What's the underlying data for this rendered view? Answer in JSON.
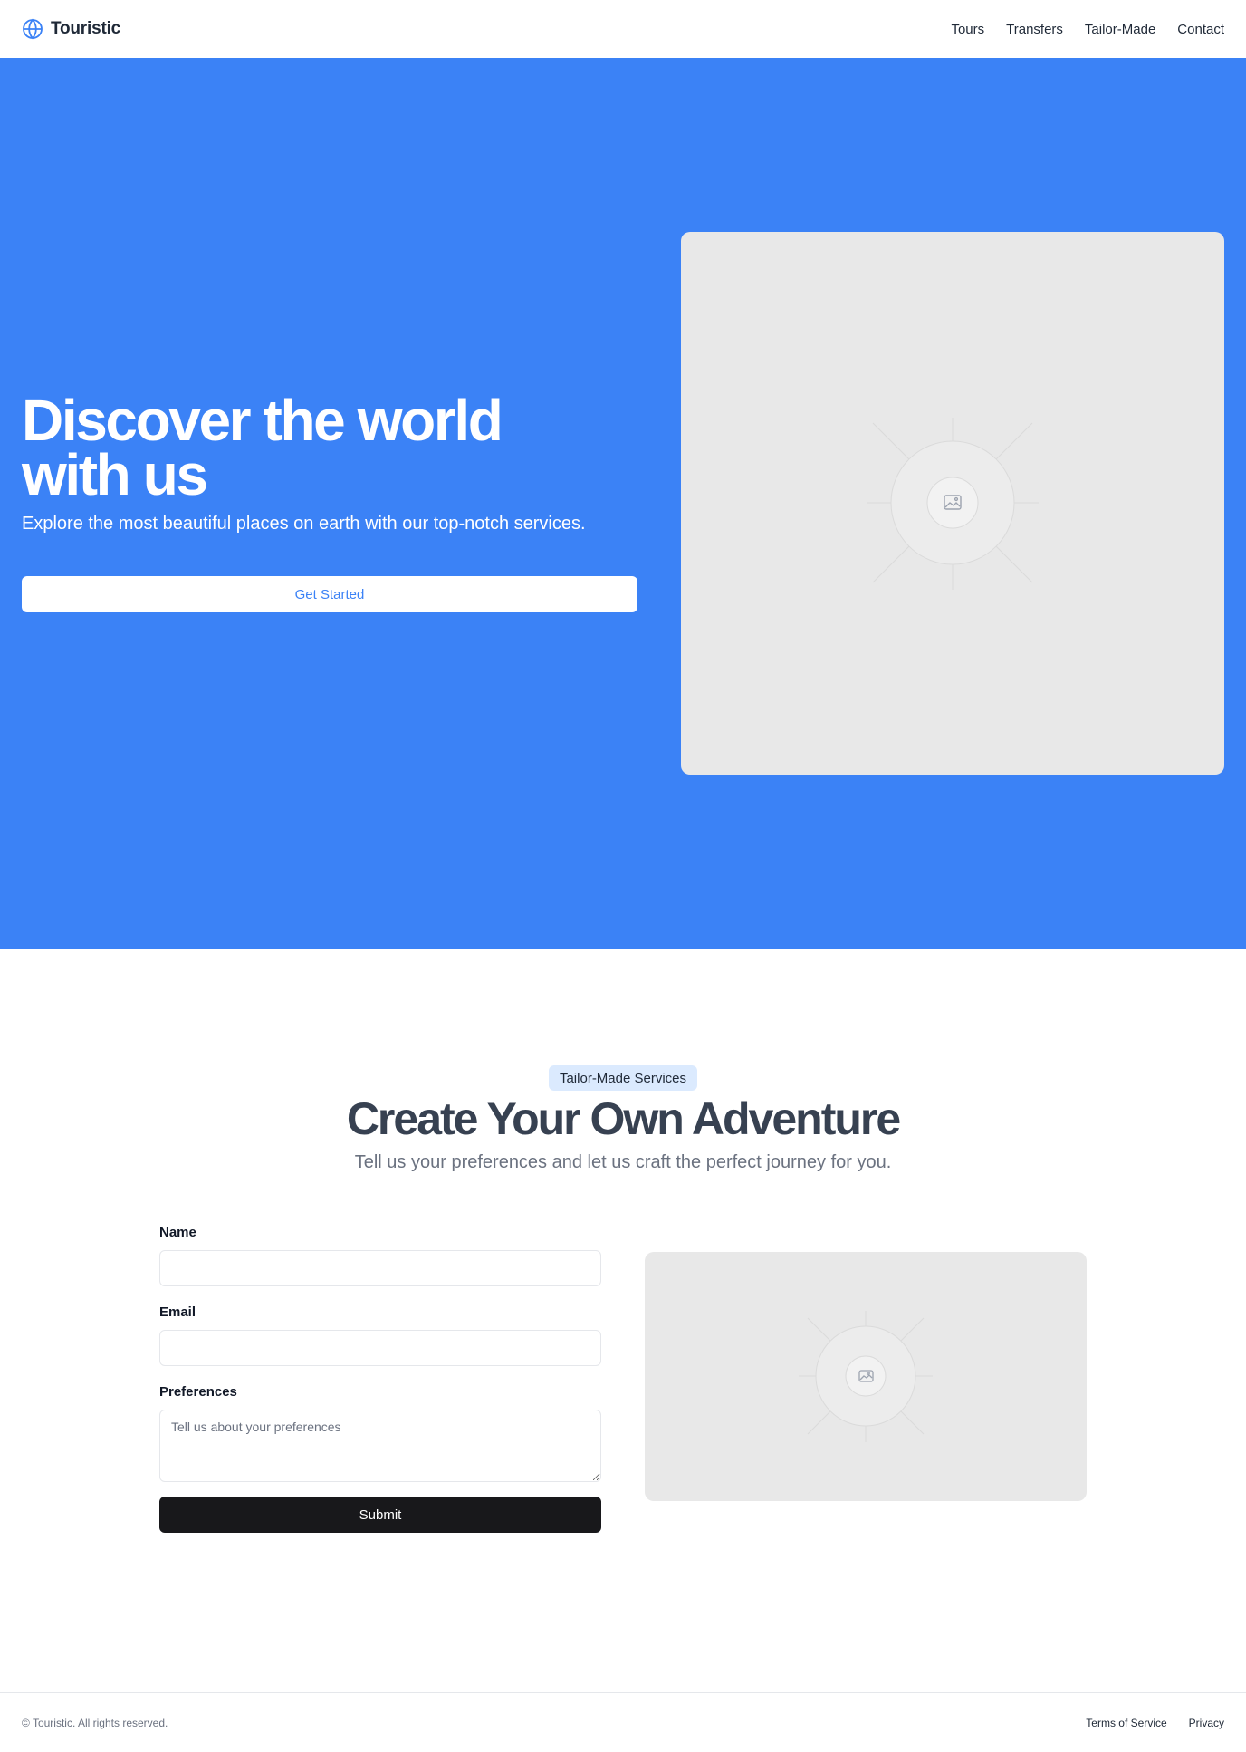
{
  "header": {
    "brand": "Touristic",
    "brand_icon": "globe-icon",
    "nav": [
      "Tours",
      "Transfers",
      "Tailor-Made",
      "Contact"
    ]
  },
  "hero": {
    "title": "Discover the world with us",
    "subtitle": "Explore the most beautiful places on earth with our top-notch services.",
    "cta_label": "Get Started",
    "image_icon": "image-placeholder-icon"
  },
  "tailor": {
    "badge": "Tailor-Made Services",
    "title": "Create Your Own Adventure",
    "subtitle": "Tell us your preferences and let us craft the perfect journey for you.",
    "form": {
      "name_label": "Name",
      "name_value": "",
      "email_label": "Email",
      "email_value": "",
      "preferences_label": "Preferences",
      "preferences_placeholder": "Tell us about your preferences",
      "submit_label": "Submit"
    },
    "image_icon": "image-placeholder-icon"
  },
  "footer": {
    "copyright": "© Touristic. All rights reserved.",
    "links": [
      "Terms of Service",
      "Privacy"
    ]
  },
  "colors": {
    "accent": "#3b82f6",
    "badge_bg": "#dbeafe",
    "submit_bg": "#18181b",
    "placeholder_bg": "#e8e8e8"
  }
}
